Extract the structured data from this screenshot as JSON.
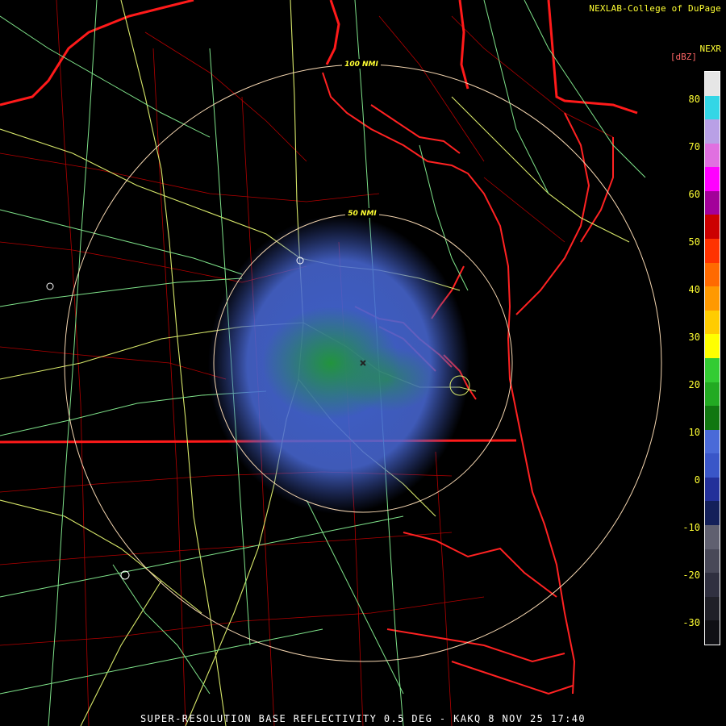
{
  "credit": "NEXLAB-College of DuPage",
  "product": "NEXR",
  "units": "[dBZ]",
  "title": "SUPER-RESOLUTION BASE REFLECTIVITY 0.5 DEG - KAKQ 8 NOV 25 17:40",
  "range_rings": [
    {
      "label": "100 NMI"
    },
    {
      "label": "50 NMI"
    }
  ],
  "colorbar": {
    "labels": [
      "80",
      "70",
      "60",
      "50",
      "40",
      "30",
      "20",
      "10",
      "0",
      "-10",
      "-20",
      "-30"
    ],
    "segments": [
      "#e6e6e6",
      "#33d6e6",
      "#b9a0e6",
      "#e070e0",
      "#ff00ff",
      "#a3009a",
      "#cc0000",
      "#ff3300",
      "#ff6a00",
      "#ff9900",
      "#ffcc00",
      "#ffff00",
      "#33cc33",
      "#22aa22",
      "#117711",
      "#4a6ad8",
      "#3a56c8",
      "#23309a",
      "#14205a",
      "#606070",
      "#484858",
      "#303040",
      "#202028",
      "#101014"
    ]
  },
  "colors": {
    "state_border": "#ff1a1a",
    "county_border": "#b30000",
    "highway": "#d8e86a",
    "highway_green": "#7fe38a",
    "echo_low": "#4a6ad8",
    "echo_green": "#1f9a2e",
    "ring": "#f5d6b0"
  }
}
